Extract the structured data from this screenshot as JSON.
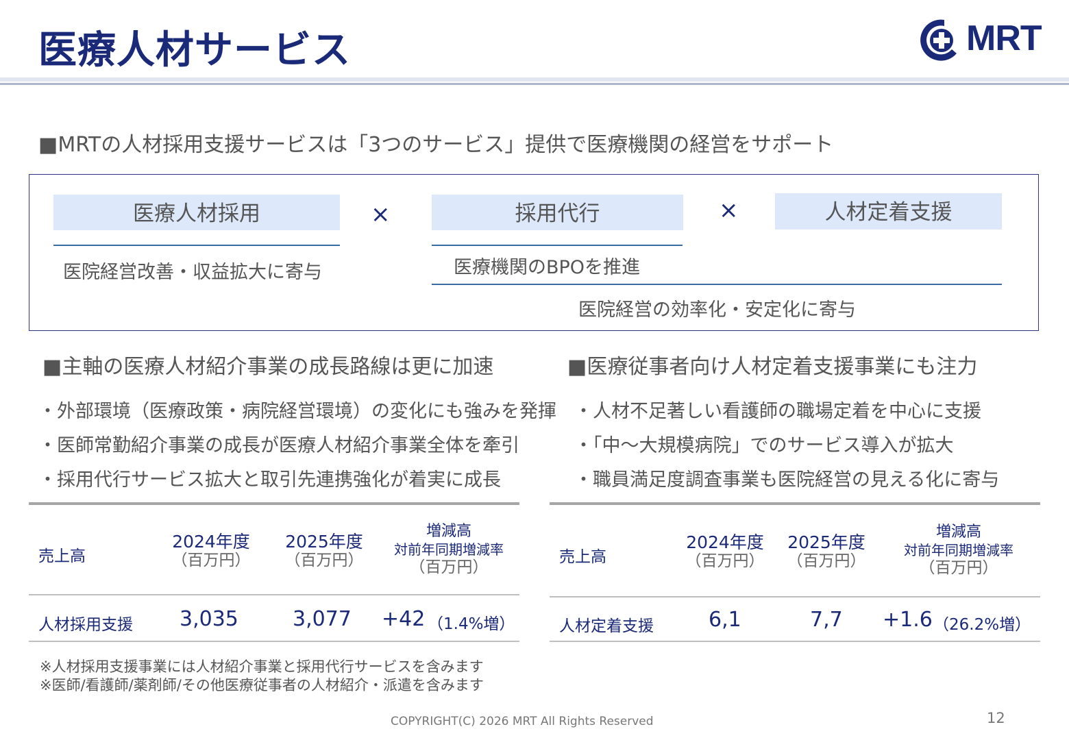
{
  "header": {
    "title": "医療人材サービス",
    "logo_text": "MRT",
    "brand_color": "#1b2a78",
    "logo_icon": "medical-cross-icon"
  },
  "intro": {
    "heading": "■MRTの人材採用支援サービスは「3つのサービス」提供で医療機関の経営をサポート"
  },
  "services": {
    "items": [
      {
        "label": "医療人材採用"
      },
      {
        "label": "採用代行"
      },
      {
        "label": "人材定着支援"
      }
    ],
    "times_symbol": "×",
    "desc_1": "医院経営改善・収益拡大に寄与",
    "desc_2": "医療機関のBPOを推進",
    "desc_3": "医院経営の効率化・安定化に寄与"
  },
  "left_section": {
    "heading": "■主軸の医療人材紹介事業の成長路線は更に加速",
    "bullets": [
      "・外部環境（医療政策・病院経営環境）の変化にも強みを発揮",
      "・医師常勤紹介事業の成長が医療人材紹介事業全体を牽引",
      "・採用代行サービス拡大と取引先連携強化が着実に成長"
    ],
    "table": {
      "col_label": "売上高",
      "col_2024": "2024年度",
      "col_2025": "2025年度",
      "unit": "（百万円）",
      "col_change_1": "増減高",
      "col_change_2": "対前年同期増減率",
      "row_label": "人材採用支援",
      "v2024": "3,035",
      "v2025": "3,077",
      "change": "+42",
      "rate": "（1.4%増）"
    }
  },
  "right_section": {
    "heading": "■医療従事者向け人材定着支援事業にも注力",
    "bullets": [
      "・人材不足著しい看護師の職場定着を中心に支援",
      "・「中～大規模病院」でのサービス導入が拡大",
      "・職員満足度調査事業も医院経営の見える化に寄与"
    ],
    "table": {
      "col_label": "売上高",
      "col_2024": "2024年度",
      "col_2025": "2025年度",
      "unit": "（百万円）",
      "col_change_1": "増減高",
      "col_change_2": "対前年同期増減率",
      "row_label": "人材定着支援",
      "v2024": "6,1",
      "v2025": "7,7",
      "change": "+1.6",
      "rate": "（26.2%増）"
    }
  },
  "notes": [
    "※人材採用支援事業には人材紹介事業と採用代行サービスを含みます",
    "※医師/看護師/薬剤師/その他医療従事者の人材紹介・派遣を含みます"
  ],
  "footer": {
    "copyright": "COPYRIGHT(C) 2026 MRT All Rights Reserved",
    "page": "12"
  }
}
